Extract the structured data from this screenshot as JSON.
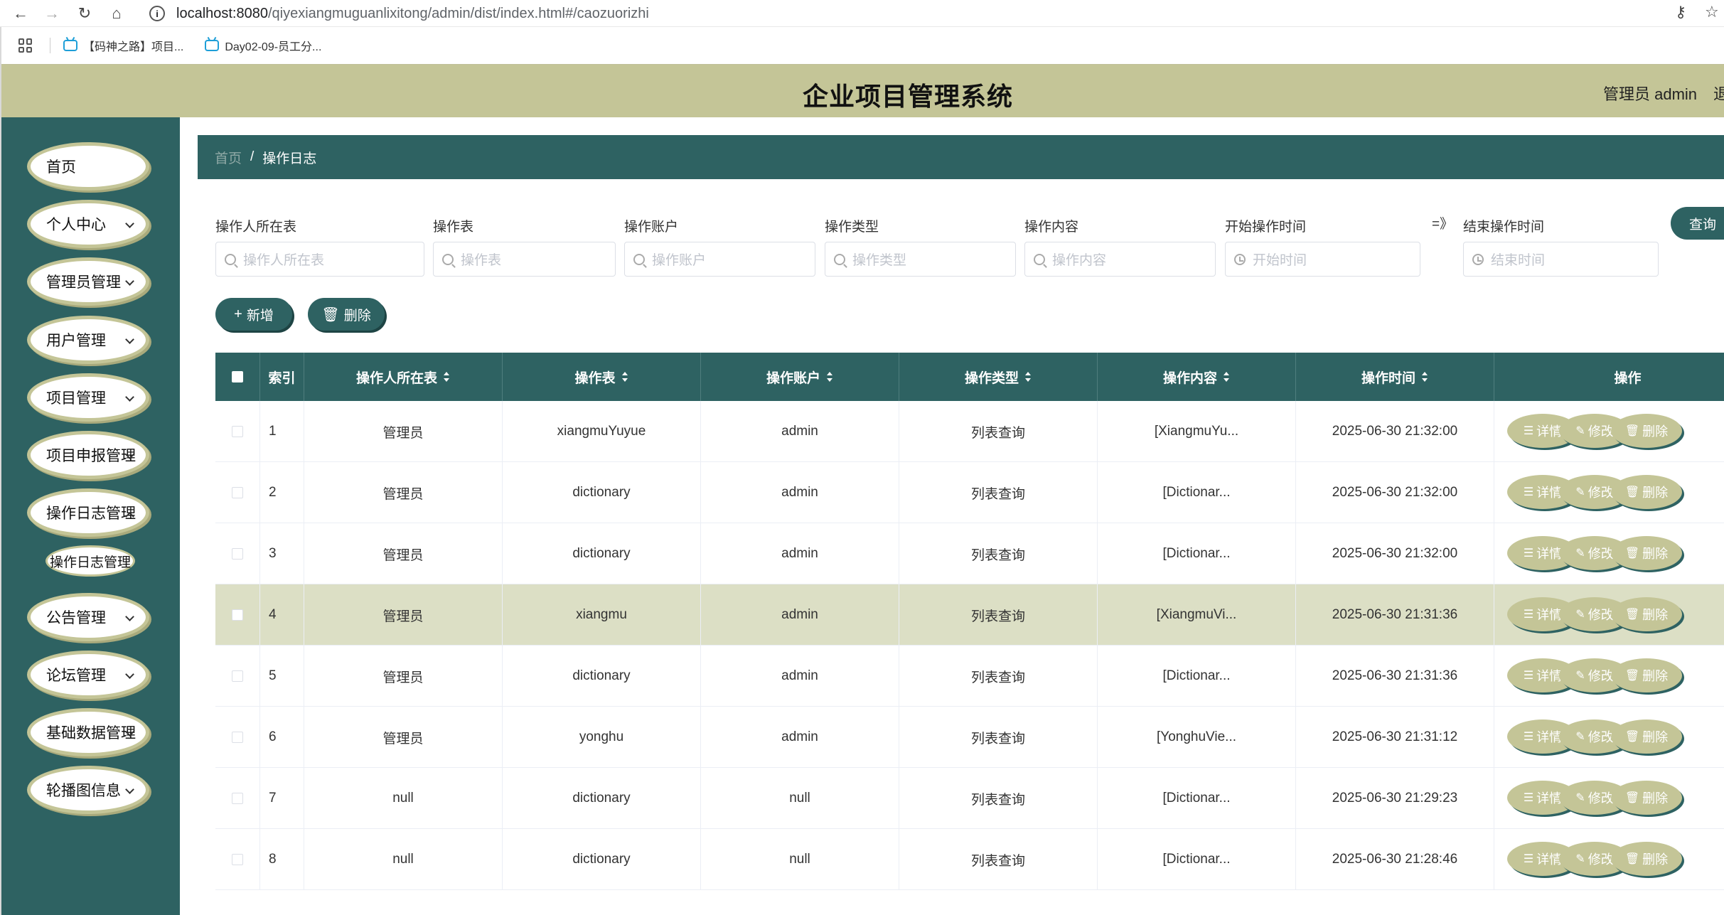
{
  "browser": {
    "url_host": "localhost:8080",
    "url_path": "/qiyexiangmuguanlixitong/admin/dist/index.html#/caozuorizhi",
    "bookmarks": [
      "【码神之路】项目...",
      "Day02-09-员工分..."
    ]
  },
  "header": {
    "title": "企业项目管理系统",
    "user": "管理员 admin",
    "logout": "退出"
  },
  "sidebar": {
    "items": [
      {
        "label": "首页"
      },
      {
        "label": "个人中心"
      },
      {
        "label": "管理员管理"
      },
      {
        "label": "用户管理"
      },
      {
        "label": "项目管理"
      },
      {
        "label": "项目申报管理"
      },
      {
        "label": "操作日志管理"
      },
      {
        "label": "公告管理"
      },
      {
        "label": "论坛管理"
      },
      {
        "label": "基础数据管理"
      },
      {
        "label": "轮播图信息"
      }
    ],
    "submenu": {
      "label": "操作日志管理"
    }
  },
  "breadcrumb": {
    "home": "首页",
    "sep": "/",
    "current": "操作日志"
  },
  "filters": {
    "fields": [
      {
        "label": "操作人所在表",
        "placeholder": "操作人所在表"
      },
      {
        "label": "操作表",
        "placeholder": "操作表"
      },
      {
        "label": "操作账户",
        "placeholder": "操作账户"
      },
      {
        "label": "操作类型",
        "placeholder": "操作类型"
      },
      {
        "label": "操作内容",
        "placeholder": "操作内容"
      },
      {
        "label": "开始操作时间",
        "placeholder": "开始时间"
      },
      {
        "label": "结束操作时间",
        "placeholder": "结束时间"
      }
    ],
    "range_sep": "=》",
    "query_label": "查询"
  },
  "actions": {
    "add_label": "新增",
    "delete_label": "删除"
  },
  "table": {
    "columns": [
      "索引",
      "操作人所在表",
      "操作表",
      "操作账户",
      "操作类型",
      "操作内容",
      "操作时间",
      "操作"
    ],
    "rows": [
      {
        "idx": "1",
        "table_owner": "管理员",
        "op_table": "xiangmuYuyue",
        "account": "admin",
        "type": "列表查询",
        "content": "[XiangmuYu...",
        "time": "2025-06-30 21:32:00"
      },
      {
        "idx": "2",
        "table_owner": "管理员",
        "op_table": "dictionary",
        "account": "admin",
        "type": "列表查询",
        "content": "[Dictionar...",
        "time": "2025-06-30 21:32:00"
      },
      {
        "idx": "3",
        "table_owner": "管理员",
        "op_table": "dictionary",
        "account": "admin",
        "type": "列表查询",
        "content": "[Dictionar...",
        "time": "2025-06-30 21:32:00"
      },
      {
        "idx": "4",
        "table_owner": "管理员",
        "op_table": "xiangmu",
        "account": "admin",
        "type": "列表查询",
        "content": "[XiangmuVi...",
        "time": "2025-06-30 21:31:36"
      },
      {
        "idx": "5",
        "table_owner": "管理员",
        "op_table": "dictionary",
        "account": "admin",
        "type": "列表查询",
        "content": "[Dictionar...",
        "time": "2025-06-30 21:31:36"
      },
      {
        "idx": "6",
        "table_owner": "管理员",
        "op_table": "yonghu",
        "account": "admin",
        "type": "列表查询",
        "content": "[YonghuVie...",
        "time": "2025-06-30 21:31:12"
      },
      {
        "idx": "7",
        "table_owner": "null",
        "op_table": "dictionary",
        "account": "null",
        "type": "列表查询",
        "content": "[Dictionar...",
        "time": "2025-06-30 21:29:23"
      },
      {
        "idx": "8",
        "table_owner": "null",
        "op_table": "dictionary",
        "account": "null",
        "type": "列表查询",
        "content": "[Dictionar...",
        "time": "2025-06-30 21:28:46"
      }
    ],
    "row_actions": {
      "detail": "详情",
      "edit": "修改",
      "delete": "删除"
    },
    "highlighted_row": 4
  },
  "colors": {
    "primary": "#2e6262",
    "accent": "#c4c597",
    "highlight_row": "#dcdfc5"
  }
}
